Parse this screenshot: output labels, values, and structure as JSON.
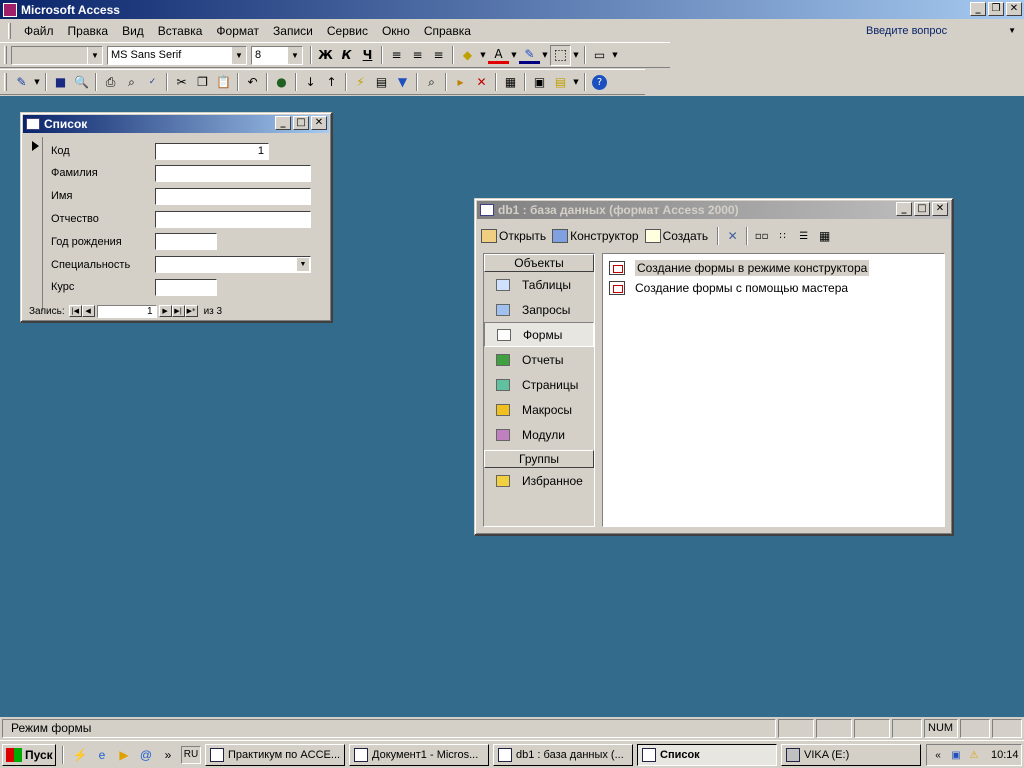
{
  "app": {
    "title": "Microsoft Access"
  },
  "menu": {
    "items": [
      "Файл",
      "Правка",
      "Вид",
      "Вставка",
      "Формат",
      "Записи",
      "Сервис",
      "Окно",
      "Справка"
    ],
    "ask_placeholder": "Введите вопрос"
  },
  "format_toolbar": {
    "font_name": "MS Sans Serif",
    "font_size": "8",
    "bold": "Ж",
    "italic": "К",
    "underline": "Ч"
  },
  "form_window": {
    "title": "Список",
    "fields": [
      {
        "label": "Код",
        "value": "1"
      },
      {
        "label": "Фамилия",
        "value": ""
      },
      {
        "label": "Имя",
        "value": ""
      },
      {
        "label": "Отчество",
        "value": ""
      },
      {
        "label": "Год рождения",
        "value": ""
      },
      {
        "label": "Специальность",
        "value": ""
      },
      {
        "label": "Курс",
        "value": ""
      }
    ],
    "nav": {
      "label": "Запись:",
      "current": "1",
      "of_text": "из 3"
    }
  },
  "db_window": {
    "title": "db1 : база данных (формат Access 2000)",
    "toolbar": {
      "open": "Открыть",
      "design": "Конструктор",
      "create": "Создать"
    },
    "objects_header": "Объекты",
    "objects": [
      "Таблицы",
      "Запросы",
      "Формы",
      "Отчеты",
      "Страницы",
      "Макросы",
      "Модули"
    ],
    "selected_object": "Формы",
    "groups_header": "Группы",
    "groups": [
      "Избранное"
    ],
    "list_items": [
      "Создание формы в режиме конструктора",
      "Создание формы с помощью мастера"
    ]
  },
  "statusbar": {
    "text": "Режим формы",
    "num": "NUM"
  },
  "taskbar": {
    "start": "Пуск",
    "lang": "RU",
    "tasks": [
      {
        "label": "Практикум по ACCE...",
        "active": false
      },
      {
        "label": "Документ1 - Micros...",
        "active": false
      },
      {
        "label": "db1 : база данных (...",
        "active": false
      },
      {
        "label": "Список",
        "active": true
      },
      {
        "label": "VIKA (E:)",
        "active": false
      }
    ],
    "clock": "10:14"
  },
  "colors": {
    "desktop": "#336b8c",
    "title_active": "#0a246a",
    "chrome": "#d4d0c8"
  }
}
